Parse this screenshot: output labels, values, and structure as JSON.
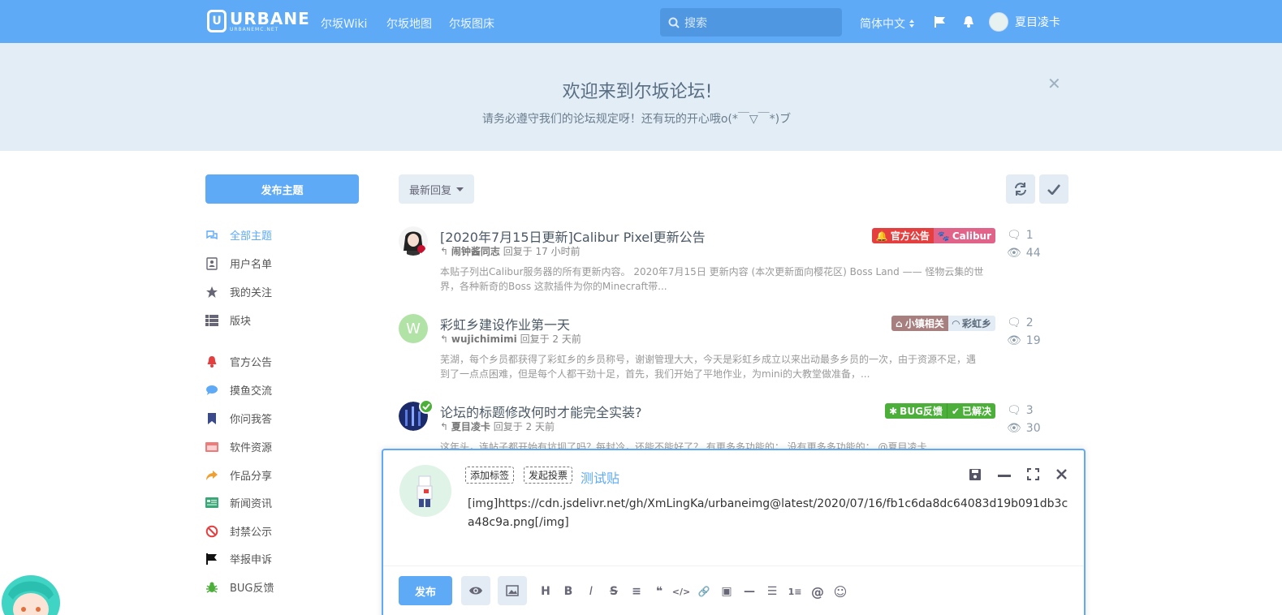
{
  "header": {
    "logo_main": "URBANE",
    "logo_sub": "URBANEMC.NET",
    "nav": [
      "尔坂Wiki",
      "尔坂地图",
      "尔坂图床"
    ],
    "search_placeholder": "搜索",
    "language": "简体中文",
    "username": "夏目凌卡",
    "bg_color": "#5eaaf7"
  },
  "hero": {
    "title": "欢迎来到尔坂论坛!",
    "subtitle": "请务必遵守我们的论坛规定呀！还有玩的开心哦o(*￣▽￣*)ブ"
  },
  "sidebar": {
    "start_button": "发布主题",
    "items": [
      {
        "label": "全部主题",
        "icon": "comments-icon",
        "active": true
      },
      {
        "label": "用户名单",
        "icon": "user-list-icon"
      },
      {
        "label": "我的关注",
        "icon": "star-icon"
      },
      {
        "label": "版块",
        "icon": "grid-icon"
      },
      {
        "label": "官方公告",
        "icon": "bell-icon",
        "color": "#e53e3e"
      },
      {
        "label": "摸鱼交流",
        "icon": "chat-bubble-icon",
        "color": "#5eaaf7"
      },
      {
        "label": "你问我答",
        "icon": "bookmark-icon",
        "color": "#3b4a8a"
      },
      {
        "label": "软件资源",
        "icon": "folder-icon",
        "color": "#ee7a7a"
      },
      {
        "label": "作品分享",
        "icon": "share-icon",
        "color": "#f0a030"
      },
      {
        "label": "新闻资讯",
        "icon": "newspaper-icon",
        "color": "#3aa876"
      },
      {
        "label": "封禁公示",
        "icon": "ban-icon",
        "color": "#e53e3e"
      },
      {
        "label": "举报申诉",
        "icon": "flag-icon",
        "color": "#111"
      },
      {
        "label": "BUG反馈",
        "icon": "bug-icon",
        "color": "#4caf3a"
      }
    ]
  },
  "toolbar": {
    "sort_label": "最新回复"
  },
  "discussions": [
    {
      "title": "[2020年7月15日更新]Calibur Pixel更新公告",
      "author": "闹钟酱同志",
      "time": "回复于 17 小时前",
      "excerpt": "本贴子列出Calibur服务器的所有更新内容。 2020年7月15日 更新内容 (本次更新面向樱花区) Boss Land —— 怪物云集的世界，各种新奇的Boss 这款插件为你的Minecraft带...",
      "tags": [
        {
          "label": "官方公告",
          "color": "#e53e3e",
          "icon": "bell-icon"
        },
        {
          "label": "Calibur",
          "color": "#e2638a",
          "icon": "paw-icon"
        }
      ],
      "replies": "1",
      "views": "44"
    },
    {
      "title": "彩虹乡建设作业第一天",
      "author": "wujichimimi",
      "time": "回复于 2 天前",
      "excerpt": "芜湖，每个乡员都获得了彩虹乡的乡员称号，谢谢管理大大，今天是彩虹乡成立以来出动最多乡员的一次，由于资源不足，遇到了一点点困难，但是每个人都干劲十足，首先，我们开始了平地作业，为mini的大教堂做准备，...",
      "avatar_letter": "W",
      "tags": [
        {
          "label": "小镇相关",
          "color": "#a87f7f",
          "icon": "home-icon"
        },
        {
          "label": "彩虹乡",
          "color": "#e3ecf4",
          "text_color": "#5a6a7a",
          "icon": "rainbow-icon"
        }
      ],
      "replies": "2",
      "views": "19"
    },
    {
      "title": "论坛的标题修改何时才能完全实装?",
      "author": "夏目凌卡",
      "time": "回复于 2 天前",
      "excerpt": "这年头，连帖子都开始有坑坝了吗？每封冷，还能不能好了？ 有更多多功能的； 没有更多多功能的； @夏目凌卡",
      "tags": [
        {
          "label": "BUG反馈",
          "color": "#4caf3a",
          "icon": "bug-icon"
        },
        {
          "label": "已解决",
          "color": "#4caf3a",
          "icon": "check-circle-icon"
        }
      ],
      "replies": "3",
      "views": "30"
    }
  ],
  "composer": {
    "add_tag": "添加标签",
    "start_poll": "发起投票",
    "title": "测试贴",
    "content": "[img]https://cdn.jsdelivr.net/gh/XmLingKa/urbaneimg@latest/2020/07/16/fb1c6da8dc64083d19b091db3ca48c9a.png[/img]",
    "post_button": "发布",
    "format_buttons": [
      "H",
      "B",
      "I",
      "S",
      "≡",
      "❝",
      "</>",
      "🔗",
      "▣",
      "—",
      "☰",
      "1≡",
      "@",
      "☺"
    ]
  }
}
